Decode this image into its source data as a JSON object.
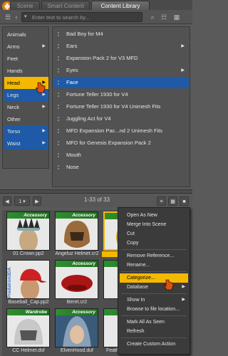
{
  "tabs": [
    {
      "label": "Scene",
      "active": false
    },
    {
      "label": "Smart Content",
      "active": false
    },
    {
      "label": "Content Library",
      "active": true
    }
  ],
  "search": {
    "placeholder": "Enter text to search by..."
  },
  "categories": [
    {
      "label": "Animals",
      "has_children": false
    },
    {
      "label": "Arms",
      "has_children": true
    },
    {
      "label": "Feet",
      "has_children": false
    },
    {
      "label": "Hands",
      "has_children": false
    },
    {
      "label": "Head",
      "has_children": true,
      "state": "hover"
    },
    {
      "label": "Legs",
      "has_children": true,
      "state": "selected"
    },
    {
      "label": "Neck",
      "has_children": true
    },
    {
      "label": "Other",
      "has_children": false
    },
    {
      "label": "Torso",
      "has_children": true,
      "state": "selected"
    },
    {
      "label": "Waist",
      "has_children": true,
      "state": "selected"
    }
  ],
  "subcategories": [
    {
      "label": "Bad Boy for M4",
      "has_children": false
    },
    {
      "label": "Ears",
      "has_children": true
    },
    {
      "label": "Expansion Pack 2 for V3 MFD",
      "has_children": false
    },
    {
      "label": "Eyes",
      "has_children": true
    },
    {
      "label": "Face",
      "has_children": false,
      "state": "selected"
    },
    {
      "label": "Fortune Teller 1930 for V4",
      "has_children": false
    },
    {
      "label": "Fortune Teller 1930 for V4 Unimesh Fits",
      "has_children": false
    },
    {
      "label": "Juggling Act for V4",
      "has_children": false
    },
    {
      "label": "MFD Expansion Pac...nd 2 Unimesh Fits",
      "has_children": false
    },
    {
      "label": "MFD for Genesis Expansion Pack 2",
      "has_children": false
    },
    {
      "label": "Mouth",
      "has_children": false
    },
    {
      "label": "Nose",
      "has_children": false
    }
  ],
  "pager": {
    "page": "1",
    "count": "1-33 of 33"
  },
  "tiles": [
    {
      "badge": "Accessory",
      "caption": "01 Crown.pp2"
    },
    {
      "badge": "Accessory",
      "caption": "Angeluz Helmet.cr2"
    },
    {
      "badge": "Accessory",
      "caption": "Anu Pi",
      "selected": true
    },
    {
      "badge": "",
      "caption": "Baseball_Cap.pp2",
      "watermark": "Predatron3DA"
    },
    {
      "badge": "Accessory",
      "caption": "Beret.cr2"
    },
    {
      "badge": "Accessory",
      "caption": "Bi"
    },
    {
      "badge": "Wardrobe",
      "caption": "CC Helmet.dsf"
    },
    {
      "badge": "Accessory",
      "caption": "ElvenHood.duf"
    },
    {
      "badge": "Accessory",
      "caption": "Feather...ask.pp2"
    }
  ],
  "context_menu": [
    {
      "label": "Open As New"
    },
    {
      "label": "Merge Into Scene"
    },
    {
      "label": "Cut"
    },
    {
      "label": "Copy"
    },
    {
      "sep": true
    },
    {
      "label": "Remove Reference..."
    },
    {
      "label": "Rename..."
    },
    {
      "sep": true
    },
    {
      "label": "Categorize...",
      "state": "hover"
    },
    {
      "label": "Database",
      "submenu": true
    },
    {
      "sep": true
    },
    {
      "label": "Show In",
      "submenu": true
    },
    {
      "label": "Browse to file location..."
    },
    {
      "sep": true
    },
    {
      "label": "Mark All As Seen"
    },
    {
      "label": "Refresh"
    },
    {
      "sep": true
    },
    {
      "label": "Create Custom Action"
    }
  ],
  "colors": {
    "accent": "#f5b800",
    "selection": "#1e5aa8",
    "badge": "#2f8f2f"
  }
}
